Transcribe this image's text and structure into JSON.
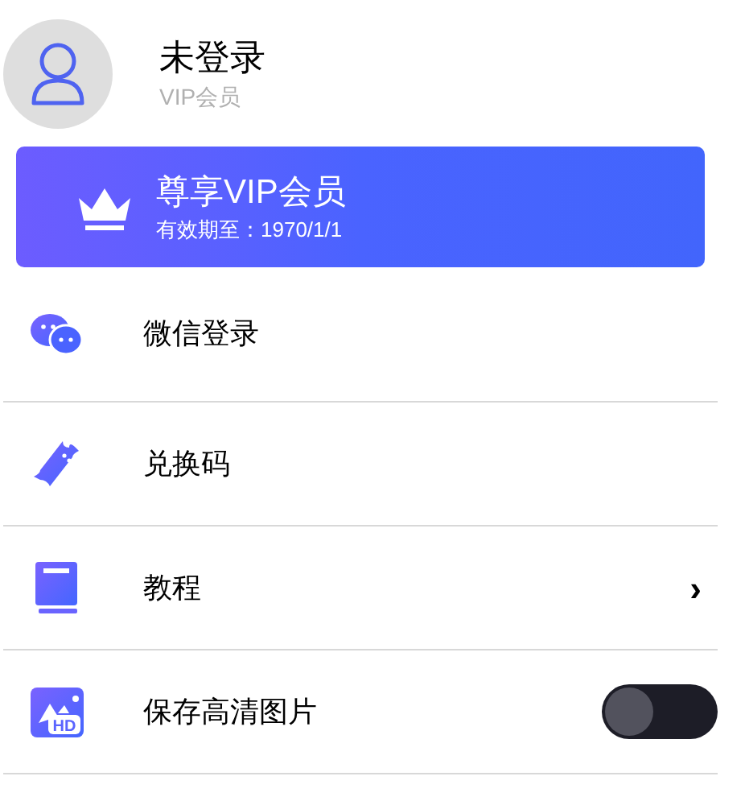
{
  "profile": {
    "name": "未登录",
    "subtitle": "VIP会员"
  },
  "vip_card": {
    "title": "尊享VIP会员",
    "expiry": "有效期至：1970/1/1"
  },
  "menu": [
    {
      "kind": "plain",
      "label": "微信登录"
    },
    {
      "kind": "plain",
      "label": "兑换码"
    },
    {
      "kind": "chevron",
      "label": "教程",
      "chevron": "›"
    },
    {
      "kind": "toggle",
      "label": "保存高清图片",
      "icon_text": "HD",
      "on": false
    }
  ]
}
